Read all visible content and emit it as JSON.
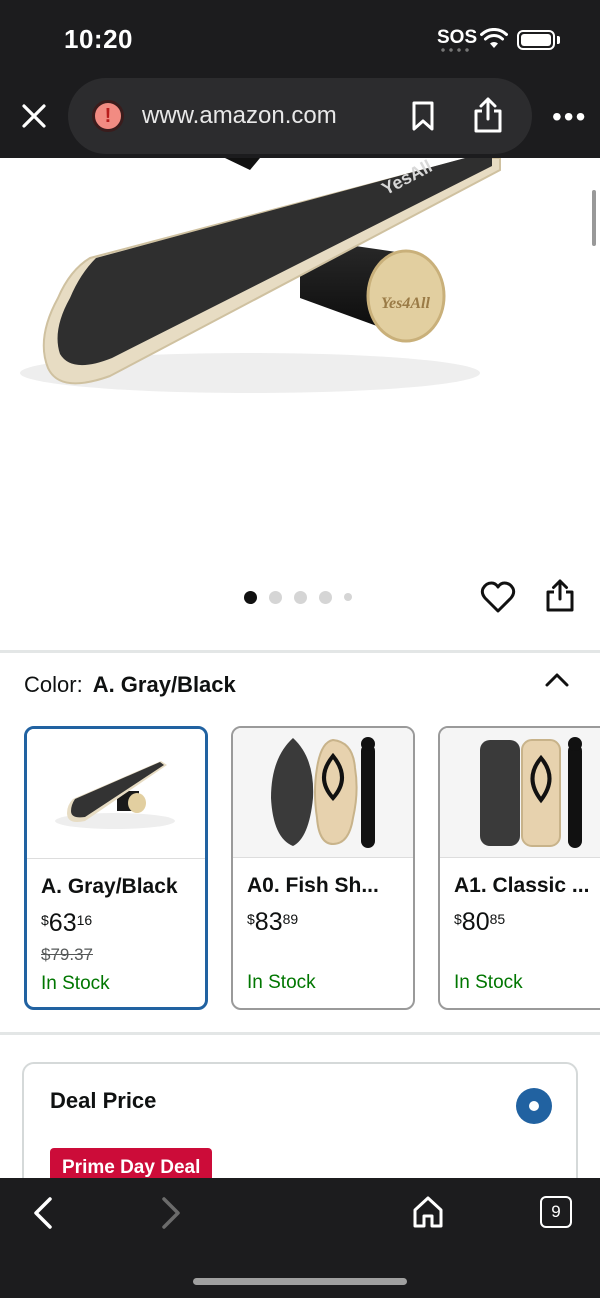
{
  "status_bar": {
    "time": "10:20",
    "sos": "SOS"
  },
  "browser": {
    "url": "www.amazon.com",
    "tab_count": "9"
  },
  "product": {
    "brand_mark": "Yes4All",
    "carousel": {
      "total": 5,
      "active": 0
    }
  },
  "color_selector": {
    "label": "Color:",
    "selected_value": "A. Gray/Black",
    "options": [
      {
        "name": "A. Gray/Black",
        "price_whole": "63",
        "price_fraction": "16",
        "currency": "$",
        "list_price": "$79.37",
        "stock": "In Stock",
        "selected": true
      },
      {
        "name": "A0. Fish Sh...",
        "price_whole": "83",
        "price_fraction": "89",
        "currency": "$",
        "list_price": "",
        "stock": "In Stock",
        "selected": false
      },
      {
        "name": "A1. Classic ...",
        "price_whole": "80",
        "price_fraction": "85",
        "currency": "$",
        "list_price": "",
        "stock": "In Stock",
        "selected": false
      }
    ]
  },
  "deal": {
    "title": "Deal Price",
    "badge": "Prime Day Deal"
  },
  "colors": {
    "accent": "#2162a1",
    "deal_red": "#cc0c39",
    "stock_green": "#007600",
    "chrome_dark": "#1c1c1e"
  }
}
